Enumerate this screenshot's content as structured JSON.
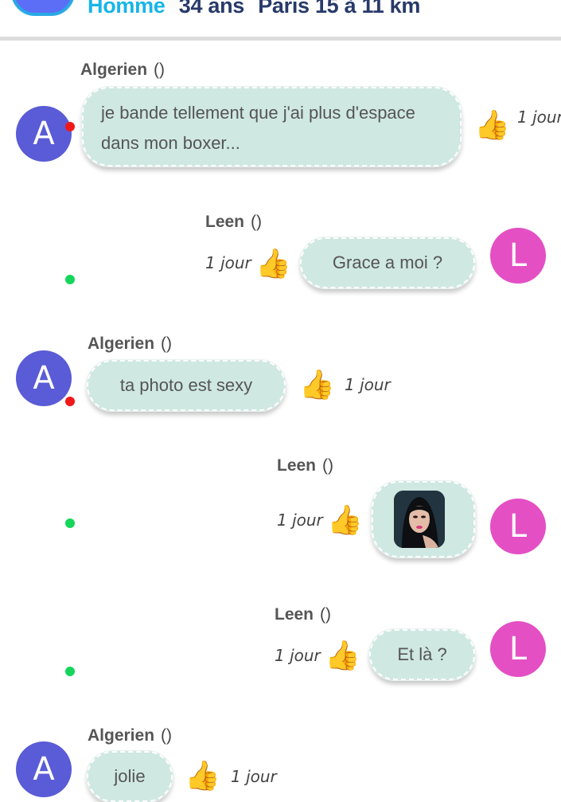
{
  "header": {
    "gender": "Homme",
    "age": "34 ans",
    "location": "Paris 15 à 11 km"
  },
  "messages": [
    {
      "author": "Algerien",
      "paren": "()",
      "avatar_letter": "A",
      "text": "je bande tellement que j'ai plus d'espace dans mon boxer...",
      "time": "1 jour",
      "reaction": "thumbs-up",
      "side": "left"
    },
    {
      "author": "Leen",
      "paren": "()",
      "avatar_letter": "L",
      "text": "Grace a moi ?",
      "time": "1 jour",
      "reaction": "thumbs-up",
      "side": "right"
    },
    {
      "author": "Algerien",
      "paren": "()",
      "avatar_letter": "A",
      "text": "ta photo est sexy",
      "time": "1 jour",
      "reaction": "thumbs-up",
      "side": "left"
    },
    {
      "author": "Leen",
      "paren": "()",
      "avatar_letter": "L",
      "text": "",
      "attachment": "photo",
      "time": "1 jour",
      "reaction": "thumbs-up",
      "side": "right"
    },
    {
      "author": "Leen",
      "paren": "()",
      "avatar_letter": "L",
      "text": "Et là ?",
      "time": "1 jour",
      "reaction": "thumbs-up",
      "side": "right"
    },
    {
      "author": "Algerien",
      "paren": "()",
      "avatar_letter": "A",
      "text": "jolie",
      "time": "1 jour",
      "reaction": "thumbs-up",
      "side": "left"
    }
  ],
  "colors": {
    "bubble": "#cfe8e2",
    "avatar_a": "#5a5bd6",
    "avatar_l": "#e44fc4",
    "online": "#15d65a",
    "offline": "#f01818",
    "header_accent": "#1aaee6"
  }
}
